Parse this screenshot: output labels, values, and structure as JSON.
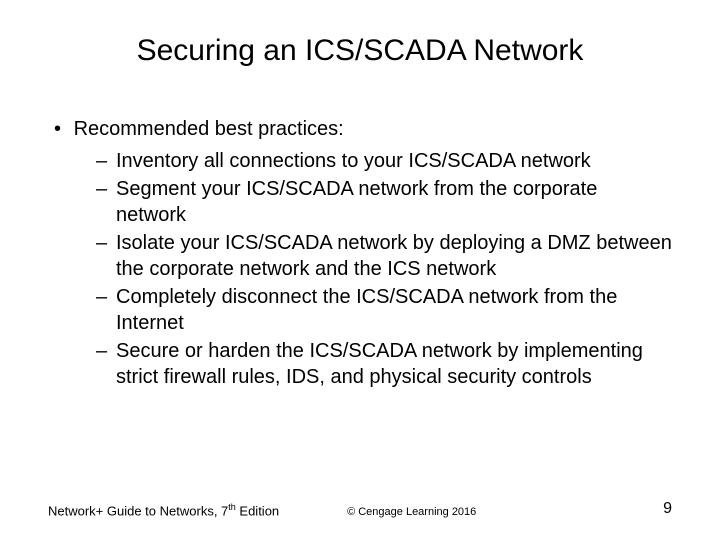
{
  "title": "Securing an ICS/SCADA Network",
  "lead": "Recommended best practices:",
  "items": [
    "Inventory all connections to your ICS/SCADA network",
    "Segment your ICS/SCADA network from the corporate network",
    "Isolate your ICS/SCADA network by deploying a DMZ between the corporate network and the ICS network",
    "Completely disconnect the ICS/SCADA network from the Internet",
    "Secure or harden the ICS/SCADA network by implementing strict firewall rules, IDS, and physical security controls"
  ],
  "footer": {
    "left_pre": "Network+ Guide to Networks, 7",
    "left_sup": "th",
    "left_post": " Edition",
    "center": "© Cengage Learning 2016",
    "page": "9"
  }
}
